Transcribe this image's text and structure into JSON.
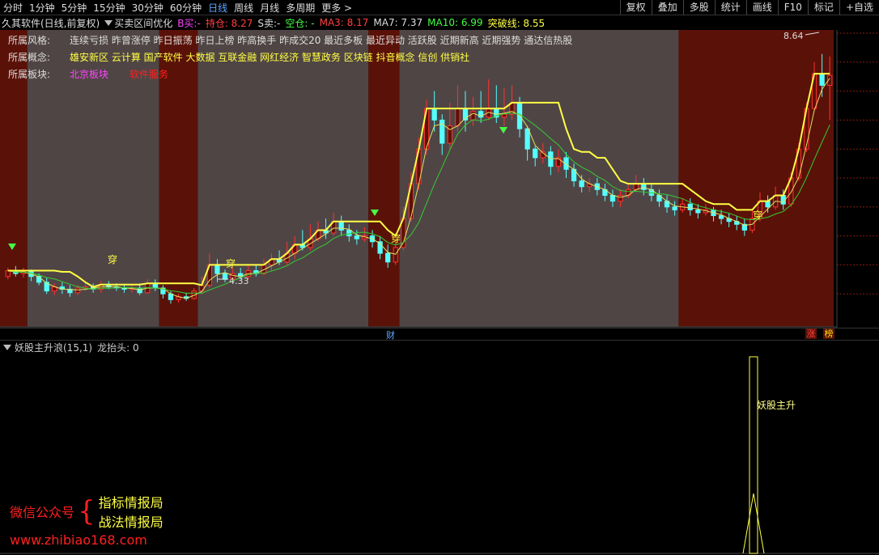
{
  "topbar": {
    "timeframes": [
      "分时",
      "1分钟",
      "5分钟",
      "15分钟",
      "30分钟",
      "60分钟",
      "日线",
      "周线",
      "月线",
      "多周期",
      "更多 >"
    ],
    "active_timeframe": "日线",
    "right_buttons": [
      "复权",
      "叠加",
      "多股",
      "统计",
      "画线",
      "F10",
      "标记",
      "+自选"
    ]
  },
  "infobar": {
    "title": "久其软件(日线,前复权)",
    "indicator_name": "买卖区间优化",
    "b_sell": "B买:-",
    "hold": "持仓: 8.27",
    "s_sell": "S卖:-",
    "empty": "空仓: -",
    "ma3": "MA3: 8.17",
    "ma7": "MA7: 7.37",
    "ma10": "MA10: 6.99",
    "break_line": "突破线: 8.55"
  },
  "info_panel": {
    "style_label": "所属风格:",
    "style_value": "连续亏损 昨曾涨停 昨日振荡 昨日上榜 昨高换手 昨成交20 最近多板 最近异动 活跃股 近期新高 近期强势 通达信热股",
    "concept_label": "所属概念:",
    "concept_value": "雄安新区 云计算 国产软件 大数据 互联金融 网红经济 智慧政务 区块链 抖音概念 信创 供销社",
    "sector_label": "所属板块:",
    "sector_value1": "北京板块",
    "sector_value2": "软件服务"
  },
  "chart_labels": {
    "high": "8.64",
    "low": "4.33",
    "chuan": "穿",
    "cai": "财",
    "zhang": "涨",
    "bang": "榜",
    "signal": "妖股主升"
  },
  "lower": {
    "title": "妖股主升浪(15,1)",
    "longtaitou": "龙抬头: 0"
  },
  "watermark": {
    "wechat": "微信公众号",
    "line1": "指标情报局",
    "line2": "战法情报局",
    "url": "www.zhibiao168.com"
  },
  "colors": {
    "up": "#ff3232",
    "down": "#54ffff",
    "yellow_line": "#ffff44",
    "ma_green": "#33cc33",
    "ma_yellow": "#e0e060",
    "zone_gray": "#504545",
    "zone_red": "#5a1208"
  },
  "chart_data": {
    "type": "candlestick",
    "price_range": [
      4.0,
      9.0
    ],
    "high_marker": 8.64,
    "low_marker": 4.33,
    "candles": [
      [
        4.8,
        4.9,
        4.95,
        4.75
      ],
      [
        4.9,
        4.85,
        4.98,
        4.8
      ],
      [
        4.85,
        4.88,
        4.95,
        4.78
      ],
      [
        4.88,
        4.8,
        4.92,
        4.72
      ],
      [
        4.8,
        4.7,
        4.85,
        4.65
      ],
      [
        4.7,
        4.55,
        4.78,
        4.5
      ],
      [
        4.55,
        4.62,
        4.68,
        4.48
      ],
      [
        4.62,
        4.58,
        4.7,
        4.5
      ],
      [
        4.58,
        4.52,
        4.65,
        4.45
      ],
      [
        4.52,
        4.6,
        4.65,
        4.48
      ],
      [
        4.6,
        4.62,
        4.7,
        4.55
      ],
      [
        4.62,
        4.58,
        4.68,
        4.52
      ],
      [
        4.58,
        4.66,
        4.72,
        4.52
      ],
      [
        4.66,
        4.62,
        4.72,
        4.58
      ],
      [
        4.62,
        4.6,
        4.68,
        4.55
      ],
      [
        4.6,
        4.58,
        4.66,
        4.52
      ],
      [
        4.58,
        4.6,
        4.66,
        4.52
      ],
      [
        4.6,
        4.52,
        4.68,
        4.48
      ],
      [
        4.52,
        4.68,
        4.75,
        4.5
      ],
      [
        4.68,
        4.6,
        4.75,
        4.55
      ],
      [
        4.6,
        4.5,
        4.65,
        4.42
      ],
      [
        4.5,
        4.4,
        4.55,
        4.33
      ],
      [
        4.4,
        4.45,
        4.5,
        4.35
      ],
      [
        4.45,
        4.42,
        4.52,
        4.38
      ],
      [
        4.42,
        4.55,
        4.6,
        4.4
      ],
      [
        4.55,
        4.65,
        4.8,
        4.5
      ],
      [
        4.65,
        5.0,
        5.2,
        4.6
      ],
      [
        5.0,
        4.85,
        5.1,
        4.7
      ],
      [
        4.85,
        4.75,
        4.92,
        4.7
      ],
      [
        4.75,
        4.85,
        4.95,
        4.7
      ],
      [
        4.85,
        4.8,
        4.95,
        4.75
      ],
      [
        4.8,
        4.9,
        5.0,
        4.75
      ],
      [
        4.9,
        4.85,
        5.0,
        4.8
      ],
      [
        4.85,
        5.0,
        5.1,
        4.82
      ],
      [
        5.0,
        5.1,
        5.2,
        4.9
      ],
      [
        5.1,
        5.05,
        5.25,
        5.0
      ],
      [
        5.05,
        5.2,
        5.4,
        5.0
      ],
      [
        5.2,
        5.35,
        5.5,
        5.1
      ],
      [
        5.35,
        5.3,
        5.6,
        5.25
      ],
      [
        5.3,
        5.45,
        5.7,
        5.25
      ],
      [
        5.45,
        5.6,
        5.75,
        5.4
      ],
      [
        5.6,
        5.55,
        5.8,
        5.45
      ],
      [
        5.55,
        5.75,
        5.9,
        5.5
      ],
      [
        5.75,
        5.6,
        5.85,
        5.5
      ],
      [
        5.6,
        5.5,
        5.7,
        5.4
      ],
      [
        5.5,
        5.45,
        5.6,
        5.35
      ],
      [
        5.45,
        5.5,
        5.65,
        5.4
      ],
      [
        5.5,
        5.4,
        5.6,
        5.3
      ],
      [
        5.4,
        5.2,
        5.5,
        5.1
      ],
      [
        5.2,
        5.05,
        5.35,
        4.95
      ],
      [
        5.05,
        5.3,
        5.4,
        5.0
      ],
      [
        5.3,
        5.8,
        6.0,
        5.25
      ],
      [
        5.8,
        6.4,
        6.6,
        5.75
      ],
      [
        6.4,
        7.0,
        7.2,
        6.3
      ],
      [
        7.0,
        7.7,
        7.85,
        6.9
      ],
      [
        7.7,
        7.5,
        8.0,
        7.3
      ],
      [
        7.5,
        7.1,
        7.6,
        6.9
      ],
      [
        7.1,
        7.4,
        7.8,
        7.0
      ],
      [
        7.4,
        7.7,
        8.1,
        7.3
      ],
      [
        7.7,
        7.5,
        8.0,
        7.3
      ],
      [
        7.5,
        7.65,
        7.9,
        7.4
      ],
      [
        7.65,
        7.55,
        8.0,
        7.45
      ],
      [
        7.55,
        7.7,
        8.2,
        7.5
      ],
      [
        7.7,
        7.55,
        8.1,
        7.45
      ],
      [
        7.55,
        7.6,
        8.05,
        7.4
      ],
      [
        7.6,
        7.8,
        8.1,
        7.5
      ],
      [
        7.8,
        7.35,
        7.9,
        7.2
      ],
      [
        7.35,
        7.0,
        7.4,
        6.8
      ],
      [
        7.0,
        6.85,
        7.05,
        6.7
      ],
      [
        6.85,
        6.95,
        7.1,
        6.75
      ],
      [
        6.95,
        6.7,
        7.05,
        6.55
      ],
      [
        6.7,
        6.85,
        7.0,
        6.6
      ],
      [
        6.85,
        6.65,
        6.95,
        6.5
      ],
      [
        6.65,
        6.45,
        6.75,
        6.35
      ],
      [
        6.45,
        6.35,
        6.55,
        6.25
      ],
      [
        6.35,
        6.4,
        6.5,
        6.25
      ],
      [
        6.4,
        6.3,
        6.5,
        6.2
      ],
      [
        6.3,
        6.2,
        6.4,
        6.1
      ],
      [
        6.2,
        6.1,
        6.3,
        6.0
      ],
      [
        6.1,
        6.2,
        6.3,
        6.0
      ],
      [
        6.2,
        6.3,
        6.4,
        6.15
      ],
      [
        6.3,
        6.4,
        6.55,
        6.25
      ],
      [
        6.4,
        6.3,
        6.5,
        6.2
      ],
      [
        6.3,
        6.2,
        6.4,
        6.1
      ],
      [
        6.2,
        6.1,
        6.3,
        6.0
      ],
      [
        6.1,
        6.0,
        6.2,
        5.9
      ],
      [
        6.0,
        5.95,
        6.1,
        5.85
      ],
      [
        5.95,
        6.05,
        6.15,
        5.9
      ],
      [
        6.05,
        5.95,
        6.15,
        5.85
      ],
      [
        5.95,
        5.9,
        6.05,
        5.8
      ],
      [
        5.9,
        5.95,
        6.05,
        5.85
      ],
      [
        5.95,
        5.85,
        6.0,
        5.75
      ],
      [
        5.85,
        5.8,
        5.95,
        5.7
      ],
      [
        5.8,
        5.75,
        5.9,
        5.65
      ],
      [
        5.75,
        5.7,
        5.85,
        5.6
      ],
      [
        5.7,
        5.6,
        5.8,
        5.5
      ],
      [
        5.6,
        5.8,
        5.95,
        5.55
      ],
      [
        5.8,
        6.1,
        6.25,
        5.75
      ],
      [
        6.1,
        6.0,
        6.2,
        5.9
      ],
      [
        6.0,
        6.2,
        6.35,
        5.95
      ],
      [
        6.2,
        6.05,
        6.3,
        5.95
      ],
      [
        6.05,
        6.5,
        6.6,
        6.0
      ],
      [
        6.5,
        7.0,
        7.1,
        6.45
      ],
      [
        7.0,
        7.7,
        7.8,
        6.95
      ],
      [
        7.7,
        8.3,
        8.5,
        7.65
      ],
      [
        8.3,
        8.1,
        8.64,
        7.9
      ],
      [
        8.1,
        8.27,
        8.6,
        7.5
      ]
    ]
  }
}
